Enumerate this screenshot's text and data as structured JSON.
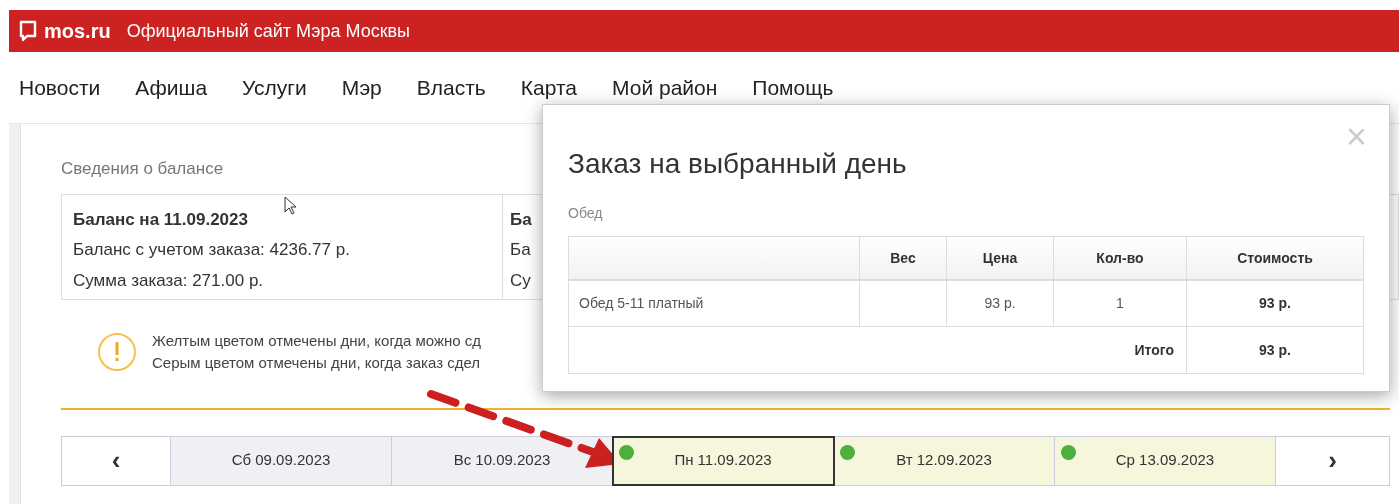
{
  "header": {
    "logo": "mos.ru",
    "title": "Официальный сайт Мэра Москвы"
  },
  "nav": [
    "Новости",
    "Афиша",
    "Услуги",
    "Мэр",
    "Власть",
    "Карта",
    "Мой район",
    "Помощь"
  ],
  "balance": {
    "heading": "Сведения о балансе",
    "cards": [
      {
        "title": "Баланс на 11.09.2023",
        "lines": [
          "Баланс с учетом заказа: 4236.77 р.",
          "Сумма заказа: 271.00 р."
        ]
      },
      {
        "title": "Ба",
        "lines": [
          "Ба",
          "Су"
        ]
      }
    ]
  },
  "note": [
    "Желтым цветом отмечены дни, когда можно сд",
    "Серым цветом отмечены дни, когда заказ сдел"
  ],
  "days": {
    "prev": "‹",
    "next": "›",
    "items": [
      {
        "label": "Сб 09.09.2023",
        "kind": "closed",
        "selected": false,
        "has_order": false
      },
      {
        "label": "Вс 10.09.2023",
        "kind": "closed",
        "selected": false,
        "has_order": false
      },
      {
        "label": "Пн 11.09.2023",
        "kind": "open",
        "selected": true,
        "has_order": true
      },
      {
        "label": "Вт 12.09.2023",
        "kind": "open",
        "selected": false,
        "has_order": true
      },
      {
        "label": "Ср 13.09.2023",
        "kind": "open",
        "selected": false,
        "has_order": true
      }
    ]
  },
  "modal": {
    "title": "Заказ на выбранный день",
    "section": "Обед",
    "close": "×",
    "columns": [
      "",
      "Вес",
      "Цена",
      "Кол-во",
      "Стоимость"
    ],
    "rows": [
      [
        "Обед 5-11 платный",
        "",
        "93 р.",
        "1",
        "93 р."
      ]
    ],
    "total": {
      "label": "Итого",
      "value": "93 р."
    }
  }
}
